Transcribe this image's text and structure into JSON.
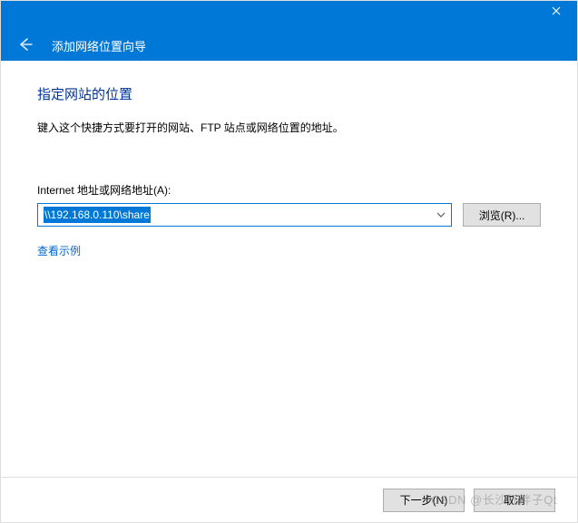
{
  "titlebar": {
    "title": "添加网络位置向导"
  },
  "content": {
    "heading": "指定网站的位置",
    "instruction": "键入这个快捷方式要打开的网站、FTP 站点或网络位置的地址。",
    "field_label": "Internet 地址或网络地址(A):",
    "address_value": "\\\\192.168.0.110\\share",
    "browse_label": "浏览(R)...",
    "examples_link": "查看示例"
  },
  "footer": {
    "next_label": "下一步(N)",
    "cancel_label": "取消"
  },
  "watermark": "CSDN @长沙红胖子Qt"
}
